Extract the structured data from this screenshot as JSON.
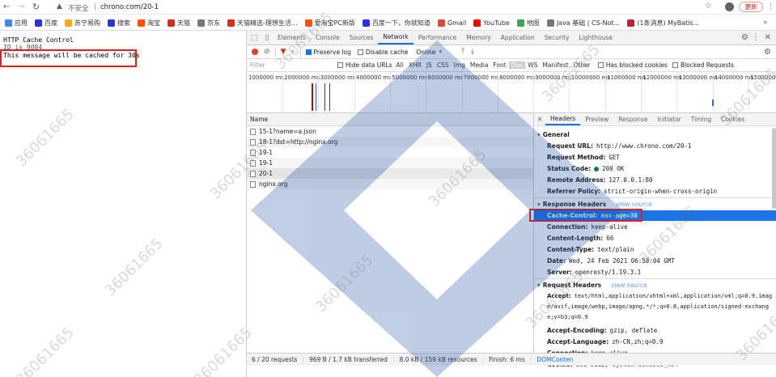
{
  "address": {
    "secure_label": "不安全",
    "separator": "|",
    "url": "chrono.com/20-1",
    "update_label": "更新"
  },
  "bookmarks": [
    {
      "label": "应用",
      "color": "#4285f4"
    },
    {
      "label": "百度",
      "color": "#2932e1"
    },
    {
      "label": "苏宁易购",
      "color": "#f5a623"
    },
    {
      "label": "搜索",
      "color": "#2932e1"
    },
    {
      "label": "淘宝",
      "color": "#ff5000"
    },
    {
      "label": "天猫",
      "color": "#e1251b"
    },
    {
      "label": "京东",
      "color": "#777777"
    },
    {
      "label": "天猫精选-理想生活...",
      "color": "#e1251b"
    },
    {
      "label": "爱淘宝PC新版",
      "color": "#ff5000"
    },
    {
      "label": "百度一下，你就知道",
      "color": "#2932e1"
    },
    {
      "label": "Gmail",
      "color": "#ea4335"
    },
    {
      "label": "YouTube",
      "color": "#ff0000"
    },
    {
      "label": "地图",
      "color": "#34a853"
    },
    {
      "label": "Java 基础 | CS-Not...",
      "color": "#777777"
    },
    {
      "label": "(1条消息) MyBatis...",
      "color": "#c32136"
    }
  ],
  "page": {
    "line1": "HTTP Cache Control",
    "line2": "ID is 9084",
    "line3": "This message will be cached for 30s"
  },
  "devtools": {
    "tabs": [
      "Elements",
      "Console",
      "Sources",
      "Network",
      "Performance",
      "Memory",
      "Application",
      "Security",
      "Lighthouse"
    ],
    "toolbar": {
      "preserve_log": "Preserve log",
      "disable_cache": "Disable cache",
      "throttle": "Online"
    },
    "filter": {
      "placeholder": "Filter",
      "hide_data_urls": "Hide data URLs",
      "types": [
        "All",
        "XHR",
        "JS",
        "CSS",
        "Img",
        "Media",
        "Font",
        "Doc",
        "WS",
        "Manifest",
        "Other"
      ],
      "blocked_cookies": "Has blocked cookies",
      "blocked_requests": "Blocked Requests"
    },
    "timeline": [
      "1000000 ms",
      "2000000 ms",
      "3000000 ms",
      "4000000 ms",
      "5000000 ms",
      "6000000 ms",
      "7000000 ms",
      "8000000 ms",
      "9000000 ms",
      "10000000 ms",
      "11000000 ms",
      "12000000 ms",
      "13000000 ms",
      "14000000 ms",
      "15000000 ms"
    ],
    "name_header": "Name",
    "requests": [
      "15-1?name=a.json",
      "18-1?dst=http://nginx.org",
      "19-1",
      "19-1",
      "20-1",
      "nginx.org"
    ],
    "detail_tabs": [
      "Headers",
      "Preview",
      "Response",
      "Initiator",
      "Timing",
      "Cookies"
    ],
    "general_title": "General",
    "general": [
      {
        "k": "Request URL:",
        "v": "http://www.chrono.com/20-1"
      },
      {
        "k": "Request Method:",
        "v": "GET"
      },
      {
        "k": "Status Code:",
        "v": "200 OK"
      },
      {
        "k": "Remote Address:",
        "v": "127.0.0.1:80"
      },
      {
        "k": "Referrer Policy:",
        "v": "strict-origin-when-cross-origin"
      }
    ],
    "response_title": "Response Headers",
    "view_source": "view source",
    "response": [
      {
        "k": "Cache-Control:",
        "v": "max-age=30"
      },
      {
        "k": "Connection:",
        "v": "keep-alive"
      },
      {
        "k": "Content-Length:",
        "v": "66"
      },
      {
        "k": "Content-Type:",
        "v": "text/plain"
      },
      {
        "k": "Date:",
        "v": "Wed, 24 Feb 2021 06:58:04 GMT"
      },
      {
        "k": "Server:",
        "v": "openresty/1.19.3.1"
      }
    ],
    "request_title": "Request Headers",
    "accept_k": "Accept:",
    "accept_v1": "text/html,application/xhtml+xml,application/xml;q=0.9,imag",
    "accept_v2": "e/avif,image/webp,image/apng,*/*;q=0.8,application/signed-exchang",
    "accept_v3": "e;v=b3;q=0.9",
    "request": [
      {
        "k": "Accept-Encoding:",
        "v": "gzip, deflate"
      },
      {
        "k": "Accept-Language:",
        "v": "zh-CN,zh;q=0.9"
      },
      {
        "k": "Connection:",
        "v": "keep-alive"
      },
      {
        "k": "Cookie:",
        "v": "sid=9112; system=Windows_x64"
      }
    ],
    "status": {
      "requests": "6 / 20 requests",
      "transferred": "969 B / 1.7 kB transferred",
      "resources": "8.0 kB / 159 kB resources",
      "finish": "Finish: 6 ms",
      "dom": "DOMConten"
    }
  },
  "watermark": "36061665"
}
